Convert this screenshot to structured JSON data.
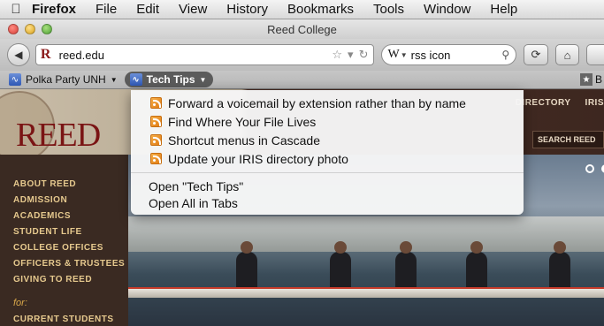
{
  "menubar": {
    "app": "Firefox",
    "items": [
      "File",
      "Edit",
      "View",
      "History",
      "Bookmarks",
      "Tools",
      "Window",
      "Help"
    ]
  },
  "window": {
    "title": "Reed College"
  },
  "toolbar": {
    "url": "reed.edu",
    "search_value": "rss icon"
  },
  "bookmarks_bar": {
    "items": [
      {
        "label": "Polka Party UNH"
      },
      {
        "label": "Tech Tips"
      }
    ],
    "right_label": "B"
  },
  "dropdown": {
    "feeds": [
      "Forward a voicemail by extension rather than by name",
      "Find Where Your File Lives",
      "Shortcut menus in Cascade",
      "Update your IRIS directory photo"
    ],
    "actions": [
      "Open \"Tech Tips\"",
      "Open All in Tabs"
    ]
  },
  "page": {
    "logo": "REED",
    "nav_right": [
      "DIRECTORY",
      "IRIS"
    ],
    "search_label": "SEARCH REED",
    "sidebar": [
      "ABOUT REED",
      "ADMISSION",
      "ACADEMICS",
      "STUDENT LIFE",
      "COLLEGE OFFICES",
      "OFFICERS & TRUSTEES",
      "GIVING TO REED"
    ],
    "for_label": "for:",
    "audience_link": "CURRENT STUDENTS"
  },
  "colors": {
    "reed_red": "#7a1414",
    "sidebar_link": "#e6c98e",
    "bookmark_active_bg": "#5b5b5b"
  }
}
